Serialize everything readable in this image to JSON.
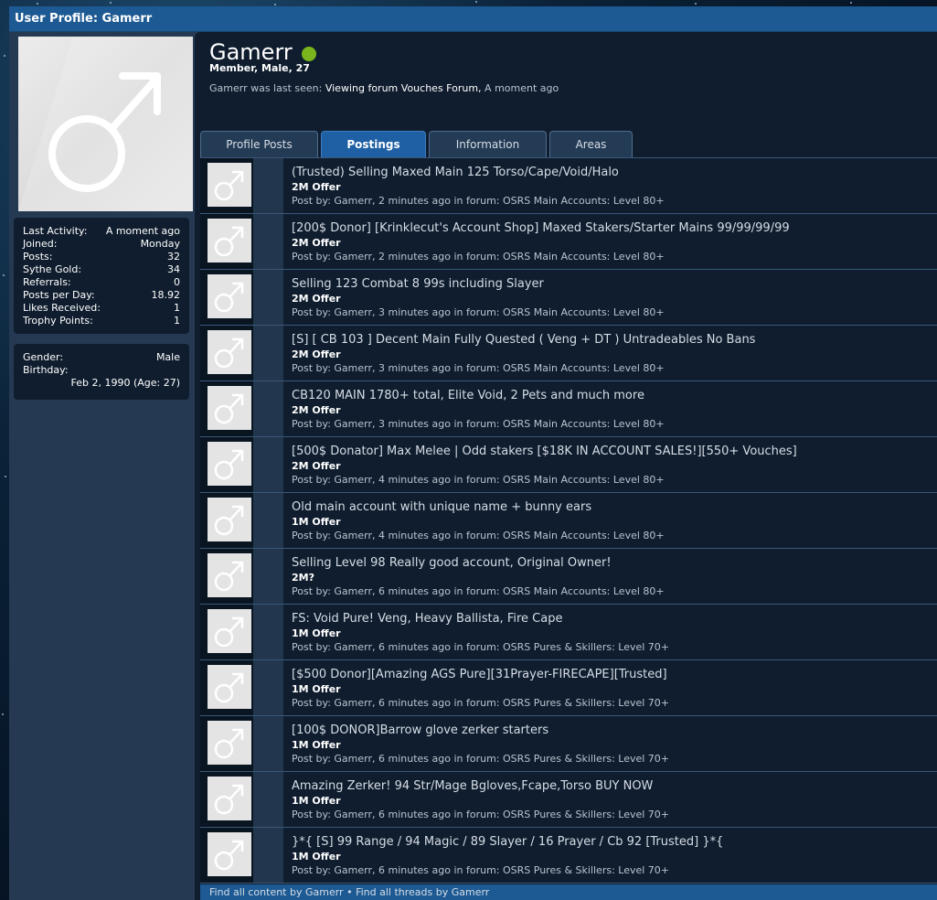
{
  "window": {
    "title": "User Profile: Gamerr"
  },
  "sidebar": {
    "stats": [
      {
        "label": "Last Activity:",
        "value": "A moment ago"
      },
      {
        "label": "Joined:",
        "value": "Monday"
      },
      {
        "label": "Posts:",
        "value": "32"
      },
      {
        "label": "Sythe Gold:",
        "value": "34"
      },
      {
        "label": "Referrals:",
        "value": "0"
      },
      {
        "label": "Posts per Day:",
        "value": "18.92"
      },
      {
        "label": "Likes Received:",
        "value": "1"
      },
      {
        "label": "Trophy Points:",
        "value": "1"
      }
    ],
    "info": {
      "gender_label": "Gender:",
      "gender_value": "Male",
      "birthday_label": "Birthday:",
      "birthday_value": "Feb 2, 1990 (Age: 27)"
    }
  },
  "profile": {
    "username": "Gamerr",
    "status_color": "#7ab51d",
    "subtitle": "Member, Male, 27",
    "last_seen_prefix": "Gamerr was last seen:",
    "last_seen_action": "Viewing forum",
    "last_seen_forum": "Vouches Forum,",
    "last_seen_time": "A moment ago"
  },
  "tabs": [
    {
      "label": "Profile Posts",
      "active": false
    },
    {
      "label": "Postings",
      "active": true
    },
    {
      "label": "Information",
      "active": false
    },
    {
      "label": "Areas",
      "active": false
    }
  ],
  "postings": [
    {
      "title": "(Trusted) Selling Maxed Main 125 Torso/Cape/Void/Halo",
      "price": "2M Offer",
      "meta": "Post by: Gamerr, 2 minutes ago in forum: OSRS Main Accounts: Level 80+"
    },
    {
      "title": "[200$ Donor] [Krinklecut's Account Shop] Maxed Stakers/Starter Mains 99/99/99/99",
      "price": "2M Offer",
      "meta": "Post by: Gamerr, 2 minutes ago in forum: OSRS Main Accounts: Level 80+"
    },
    {
      "title": "Selling 123 Combat 8 99s including Slayer",
      "price": "2M Offer",
      "meta": "Post by: Gamerr, 3 minutes ago in forum: OSRS Main Accounts: Level 80+"
    },
    {
      "title": "[S] [ CB 103 ] Decent Main Fully Quested ( Veng + DT ) Untradeables No Bans",
      "price": "2M Offer",
      "meta": "Post by: Gamerr, 3 minutes ago in forum: OSRS Main Accounts: Level 80+"
    },
    {
      "title": "CB120 MAIN 1780+ total, Elite Void, 2 Pets and much more",
      "price": "2M Offer",
      "meta": "Post by: Gamerr, 3 minutes ago in forum: OSRS Main Accounts: Level 80+"
    },
    {
      "title": "[500$ Donator] Max Melee | Odd stakers [$18K IN ACCOUNT SALES!][550+ Vouches]",
      "price": "2M Offer",
      "meta": "Post by: Gamerr, 4 minutes ago in forum: OSRS Main Accounts: Level 80+"
    },
    {
      "title": "Old main account with unique name + bunny ears",
      "price": "1M Offer",
      "meta": "Post by: Gamerr, 4 minutes ago in forum: OSRS Main Accounts: Level 80+"
    },
    {
      "title": "Selling Level 98 Really good account, Original Owner!",
      "price": "2M?",
      "meta": "Post by: Gamerr, 6 minutes ago in forum: OSRS Main Accounts: Level 80+"
    },
    {
      "title": "FS: Void Pure! Veng, Heavy Ballista, Fire Cape",
      "price": "1M Offer",
      "meta": "Post by: Gamerr, 6 minutes ago in forum: OSRS Pures & Skillers: Level 70+"
    },
    {
      "title": "[$500 Donor][Amazing AGS Pure][31Prayer-FIRECAPE][Trusted]",
      "price": "1M Offer",
      "meta": "Post by: Gamerr, 6 minutes ago in forum: OSRS Pures & Skillers: Level 70+"
    },
    {
      "title": "[100$ DONOR]Barrow glove zerker starters",
      "price": "1M Offer",
      "meta": "Post by: Gamerr, 6 minutes ago in forum: OSRS Pures & Skillers: Level 70+"
    },
    {
      "title": "Amazing Zerker! 94 Str/Mage Bgloves,Fcape,Torso BUY NOW",
      "price": "1M Offer",
      "meta": "Post by: Gamerr, 6 minutes ago in forum: OSRS Pures & Skillers: Level 70+"
    },
    {
      "title": "}*{ [S] 99 Range / 94 Magic / 89 Slayer / 16 Prayer / Cb 92 [Trusted] }*{",
      "price": "1M Offer",
      "meta": "Post by: Gamerr, 6 minutes ago in forum: OSRS Pures & Skillers: Level 70+"
    }
  ],
  "footer": {
    "links": "Find all content by Gamerr • Find all threads by Gamerr"
  },
  "icons": {
    "avatar": "male-symbol-icon",
    "status": "online-dot-icon"
  }
}
